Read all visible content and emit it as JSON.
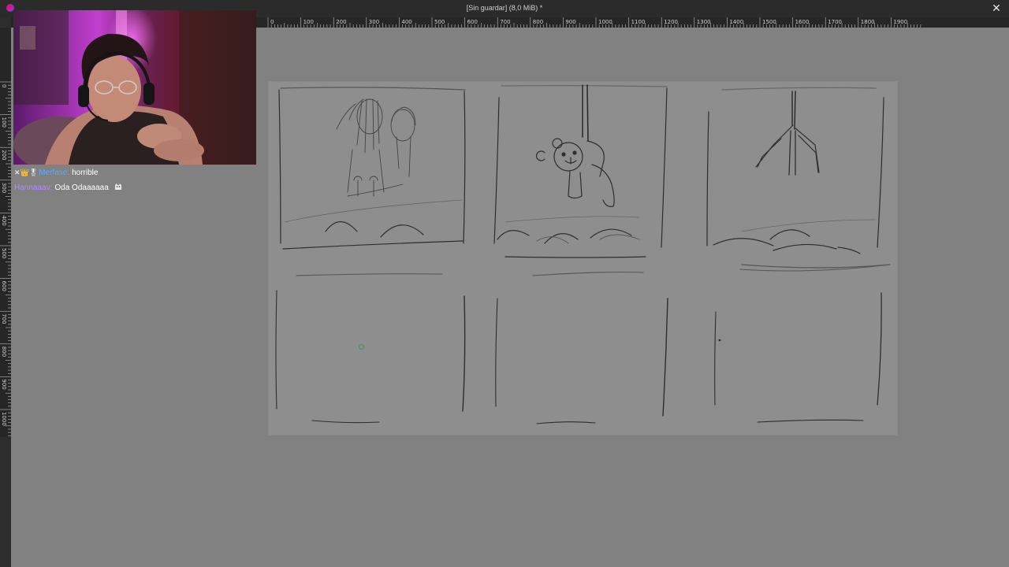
{
  "window": {
    "title": "[Sin guardar]  (8,0 MiB) *",
    "close_icon": "close-icon"
  },
  "rulers": {
    "horizontal_labels": [
      "0",
      "100",
      "200",
      "300",
      "400",
      "500",
      "600",
      "700",
      "800",
      "900",
      "1000",
      "1100",
      "1200",
      "1300",
      "1400",
      "1500",
      "1600",
      "1700",
      "1800",
      "1900"
    ],
    "vertical_labels": [
      "0",
      "100",
      "200",
      "300",
      "400",
      "500",
      "600",
      "700",
      "800",
      "900",
      "1000"
    ]
  },
  "chat": {
    "messages": [
      {
        "badges": "✕👑🎖",
        "user": "Merfase:",
        "text": "horrible"
      },
      {
        "badges": "",
        "user": "Hannaaav:",
        "text": "Oda Odaaaaaa",
        "emote": "cat-emote"
      }
    ]
  },
  "colors": {
    "titlebar": "#2b2b2b",
    "canvas_bg": "#818181",
    "page": "#8e8e8e",
    "ink": "#2e2e2e"
  }
}
